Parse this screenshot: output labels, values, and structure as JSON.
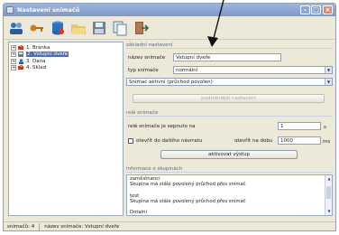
{
  "window": {
    "title": "Nastavení snímačů"
  },
  "toolbar": {
    "icons": [
      "users-icon",
      "key-icon",
      "database-icon",
      "folder-open-icon",
      "save-icon",
      "copy-icon",
      "exit-icon"
    ]
  },
  "tree": {
    "items": [
      {
        "label": "1. Branka",
        "selected": false
      },
      {
        "label": "2. Vstupní dveře",
        "selected": true
      },
      {
        "label": "3. Dana",
        "selected": false
      },
      {
        "label": "4. Sklad",
        "selected": false
      }
    ]
  },
  "basic": {
    "section_title": "základní nastavení",
    "name_label": "název snímače",
    "name_value": "Vstupní dveře",
    "type_label": "typ snímače",
    "type_value": "normální",
    "mode_value": "Snímač aktivní (průchod povolen)",
    "advanced_button": "podrobnější nastavení"
  },
  "relay": {
    "section_title": "relé snímače",
    "switch_label": "relé snímače je sepnuto na",
    "switch_value": "1",
    "switch_unit": "s",
    "open_label": "otevřít do dalšího návrratu",
    "duration_label": "otevřít na dobu",
    "duration_value": "1000",
    "duration_unit": "ms",
    "activate_button": "aktivovat výstup"
  },
  "groups": {
    "section_title": "informace o skupinách",
    "lines": [
      "zaměstnanci",
      "Skupina má stále povolený průchod přes snímač",
      "",
      "test",
      "Skupina má stále povolený průchod přes snímač",
      "",
      "Dotaini"
    ]
  },
  "status": {
    "count": "snímačů: 4",
    "name": "název snímače: Vstupní dveře"
  }
}
